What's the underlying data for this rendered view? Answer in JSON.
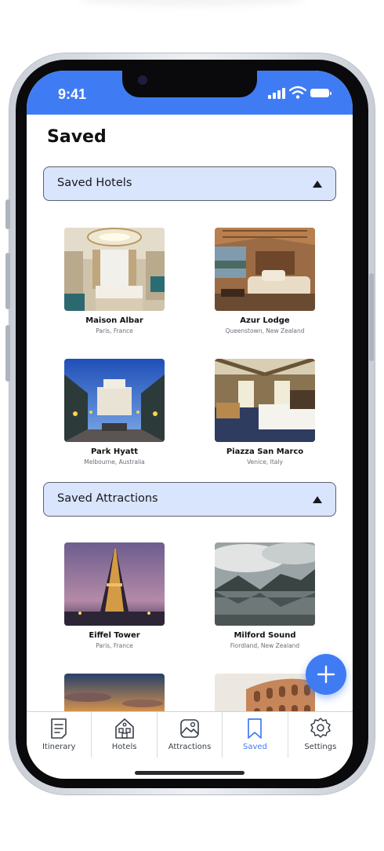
{
  "status_bar": {
    "time": "9:41"
  },
  "page": {
    "title": "Saved"
  },
  "sections": {
    "hotels": {
      "label": "Saved Hotels"
    },
    "attractions": {
      "label": "Saved Attractions"
    }
  },
  "hotels": [
    {
      "name": "Maison Albar",
      "location": "Paris, France"
    },
    {
      "name": "Azur Lodge",
      "location": "Queenstown, New Zealand"
    },
    {
      "name": "Park Hyatt",
      "location": "Melbourne, Australia"
    },
    {
      "name": "Piazza San Marco",
      "location": "Venice, Italy"
    }
  ],
  "attractions": [
    {
      "name": "Eiffel Tower",
      "location": "Paris, France"
    },
    {
      "name": "Milford Sound",
      "location": "Fiordland, New Zealand"
    }
  ],
  "tabs": [
    {
      "label": "Itinerary",
      "icon": "itinerary-icon"
    },
    {
      "label": "Hotels",
      "icon": "hotels-icon"
    },
    {
      "label": "Attractions",
      "icon": "attractions-icon"
    },
    {
      "label": "Saved",
      "icon": "bookmark-icon",
      "active": true
    },
    {
      "label": "Settings",
      "icon": "gear-icon"
    }
  ],
  "colors": {
    "accent": "#3f7cf4",
    "section_bg": "#d9e4fd"
  }
}
